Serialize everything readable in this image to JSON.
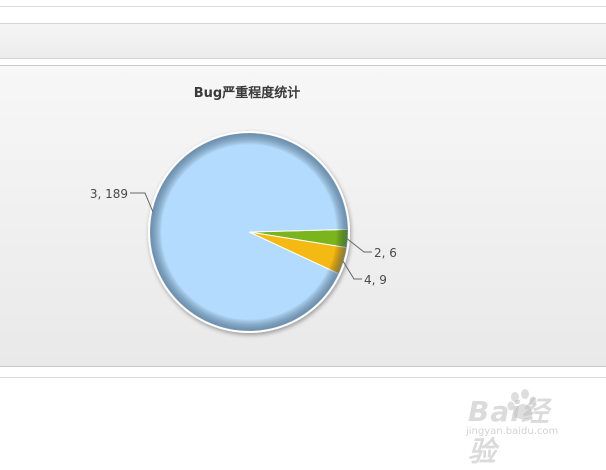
{
  "chart_data": {
    "type": "pie",
    "title": "Bug严重程度统计",
    "slices": [
      {
        "label": "3, 189",
        "value": 189,
        "color": "#b2dbfd"
      },
      {
        "label": "2, 6",
        "value": 6,
        "color": "#7ab51d"
      },
      {
        "label": "4, 9",
        "value": 9,
        "color": "#f5b914"
      }
    ],
    "legend": "none"
  },
  "watermark": {
    "text": "Bai经验",
    "sub": "jingyan.baidu.com"
  }
}
